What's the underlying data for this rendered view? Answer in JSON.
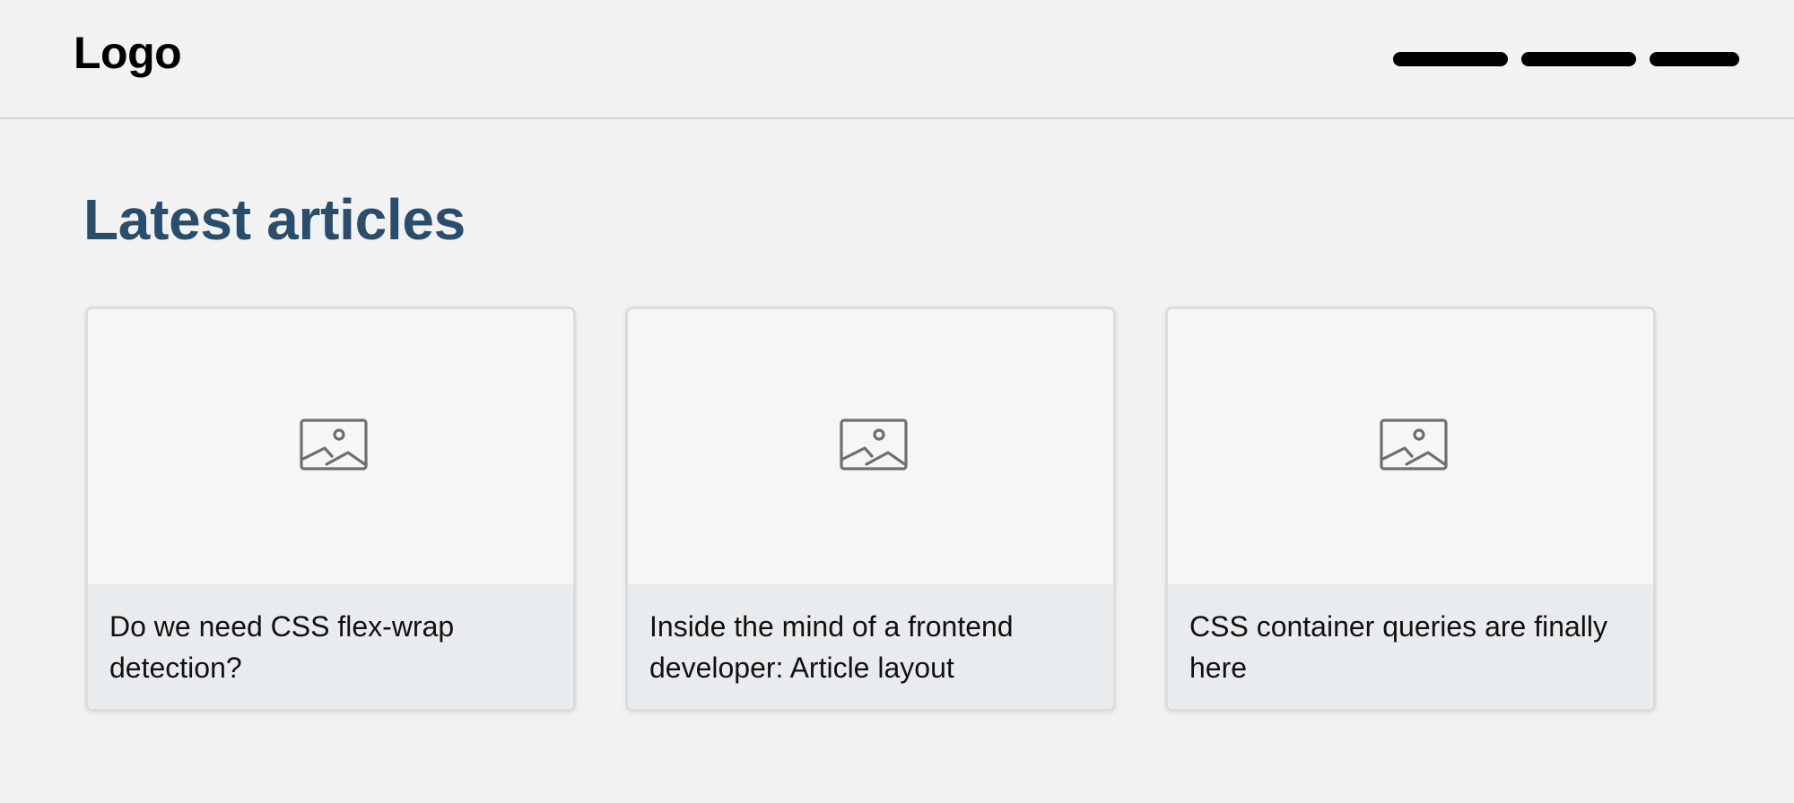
{
  "header": {
    "logo": "Logo",
    "nav_items": [
      {
        "icon": "nav-placeholder-bar"
      },
      {
        "icon": "nav-placeholder-bar"
      },
      {
        "icon": "nav-placeholder-bar"
      }
    ]
  },
  "main": {
    "heading": "Latest articles",
    "cards": [
      {
        "image_icon": "image-placeholder-icon",
        "title": "Do we need CSS flex-wrap detection?"
      },
      {
        "image_icon": "image-placeholder-icon",
        "title": "Inside the mind of a frontend developer: Article layout"
      },
      {
        "image_icon": "image-placeholder-icon",
        "title": "CSS container queries are finally here"
      }
    ]
  },
  "colors": {
    "background": "#f2f2f2",
    "heading": "#2a4d6c",
    "card_image_bg": "#f5f6f8",
    "card_body_bg": "#e9ecef",
    "nav_bar": "#000000"
  }
}
